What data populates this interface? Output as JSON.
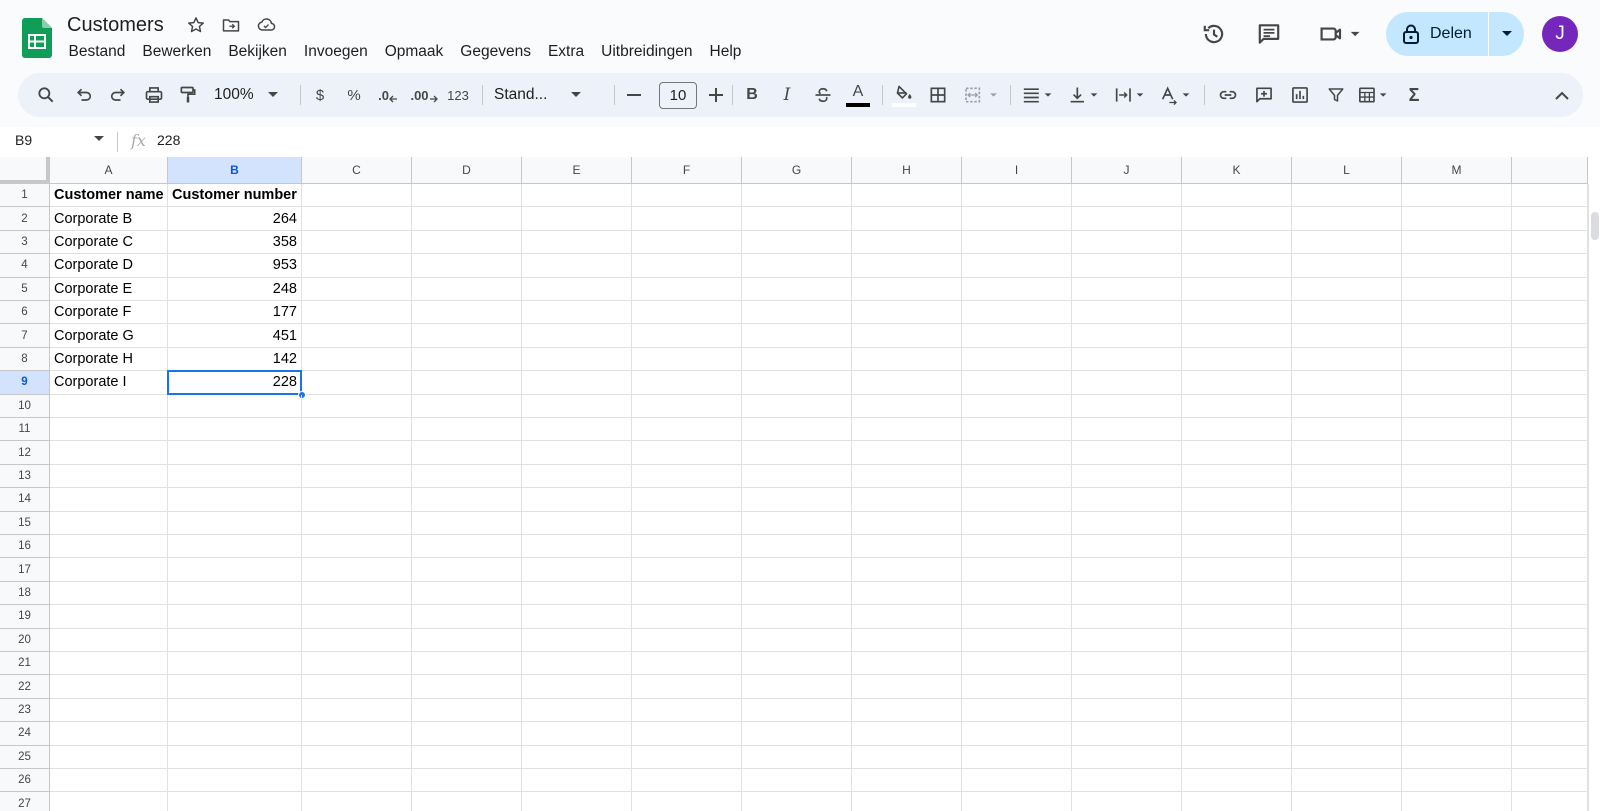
{
  "doc": {
    "title": "Customers"
  },
  "menu": [
    "Bestand",
    "Bewerken",
    "Bekijken",
    "Invoegen",
    "Opmaak",
    "Gegevens",
    "Extra",
    "Uitbreidingen",
    "Help"
  ],
  "share": {
    "label": "Delen"
  },
  "user": {
    "initial": "J",
    "color": "#7627bb"
  },
  "toolbar": {
    "zoom": "100%",
    "currency": "$",
    "percent": "%",
    "decrease_decimals": ".0",
    "increase_decimals": ".00",
    "more_formats": "123",
    "font": "Stand...",
    "font_size": "10",
    "bold": "B",
    "italic": "I",
    "text_color_letter": "A",
    "sum": "Σ"
  },
  "formula_bar": {
    "cell_ref": "B9",
    "fx": "fx",
    "value": "228"
  },
  "columns": [
    "A",
    "B",
    "C",
    "D",
    "E",
    "F",
    "G",
    "H",
    "I",
    "J",
    "K",
    "L",
    "M"
  ],
  "selected_column": "B",
  "selected_row": 9,
  "rows": [
    {
      "num": "1",
      "a": "Customer name",
      "b": "Customer number"
    },
    {
      "num": "2",
      "a": "Corporate B",
      "b": "264"
    },
    {
      "num": "3",
      "a": "Corporate C",
      "b": "358"
    },
    {
      "num": "4",
      "a": "Corporate D",
      "b": "953"
    },
    {
      "num": "5",
      "a": "Corporate E",
      "b": "248"
    },
    {
      "num": "6",
      "a": "Corporate F",
      "b": "177"
    },
    {
      "num": "7",
      "a": "Corporate G",
      "b": "451"
    },
    {
      "num": "8",
      "a": "Corporate H",
      "b": "142"
    },
    {
      "num": "9",
      "a": "Corporate I",
      "b": "228"
    },
    {
      "num": "10",
      "a": "",
      "b": ""
    },
    {
      "num": "11",
      "a": "",
      "b": ""
    },
    {
      "num": "12",
      "a": "",
      "b": ""
    },
    {
      "num": "13",
      "a": "",
      "b": ""
    },
    {
      "num": "14",
      "a": "",
      "b": ""
    },
    {
      "num": "15",
      "a": "",
      "b": ""
    },
    {
      "num": "16",
      "a": "",
      "b": ""
    },
    {
      "num": "17",
      "a": "",
      "b": ""
    },
    {
      "num": "18",
      "a": "",
      "b": ""
    },
    {
      "num": "19",
      "a": "",
      "b": ""
    },
    {
      "num": "20",
      "a": "",
      "b": ""
    },
    {
      "num": "21",
      "a": "",
      "b": ""
    },
    {
      "num": "22",
      "a": "",
      "b": ""
    },
    {
      "num": "23",
      "a": "",
      "b": ""
    },
    {
      "num": "24",
      "a": "",
      "b": ""
    },
    {
      "num": "25",
      "a": "",
      "b": ""
    },
    {
      "num": "26",
      "a": "",
      "b": ""
    },
    {
      "num": "27",
      "a": "",
      "b": ""
    }
  ],
  "colors": {
    "accent": "#1a73e8",
    "share_bg": "#c2e7ff",
    "sheets_green": "#0f9d58"
  }
}
